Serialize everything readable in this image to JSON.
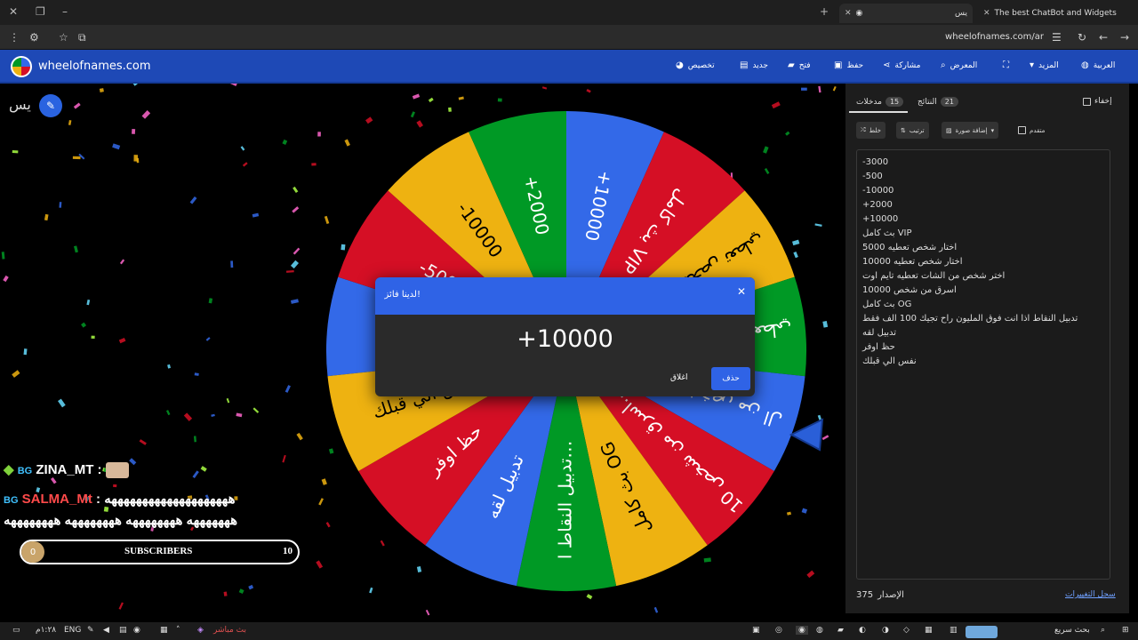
{
  "browser": {
    "tab_active_label": "يس",
    "tab_other_label": "The best ChatBot and Widgets",
    "url": "wheelofnames.com/ar"
  },
  "site": {
    "name": "wheelofnames.com",
    "nav": [
      "تخصيص",
      "جديد",
      "فتح",
      "حفظ",
      "مشاركة",
      "المعرض",
      "المزيد",
      "العربية"
    ]
  },
  "wheel": {
    "title": "يس",
    "segments": [
      "+2000",
      "+10000",
      "-3000",
      "-500",
      "-10000"
    ],
    "colors": [
      "#3369e8",
      "#d50f25",
      "#eeb211",
      "#009925"
    ]
  },
  "chat": [
    {
      "user": "ZINA_MT",
      "message": ""
    },
    {
      "user": "SALMA_Mt",
      "message": "ههههههههههههههههههههه",
      "message2": "هههههههه ههههههههه ههههههههه ههههههههه"
    }
  ],
  "subscribers": {
    "label": "SUBSCRIBERS",
    "current": "0",
    "goal": "10"
  },
  "dialog": {
    "title": "لدينا فائز!",
    "value": "+10000",
    "close_label": "اغلاق",
    "remove_label": "حذف"
  },
  "panel": {
    "tab_entries": "مدخلات",
    "tab_entries_count": "15",
    "tab_results": "النتائج",
    "tab_results_count": "21",
    "hide_label": "إخفاء",
    "shuffle_label": "خلط",
    "sort_label": "ترتيب",
    "add_image_label": "إضافة صورة",
    "advanced_label": "متقدم",
    "entries": [
      "-3000",
      "-500",
      "-10000",
      "+2000",
      "+10000",
      "بث كامل VIP",
      "اختار شخص تعطيه 5000",
      "اختار شخص تعطيه 10000",
      "اختر شخص من الشات تعطيه تايم اوت",
      "اسرق من شخص 10000",
      "بث كامل OG",
      "تدبيل النقاط اذا انت فوق المليون راح تجيك 100 الف فقط",
      "تدبيل لقه",
      "حظ اوفر",
      "نفس الي قبلك"
    ],
    "version_label": "الإصدار",
    "version_number": "375",
    "changelog_label": "سجل التغييرات"
  },
  "taskbar": {
    "live_label": "بث مباشر",
    "search_label": "بحث سريع",
    "lang": "ENG",
    "time": "١:٢٨م"
  }
}
